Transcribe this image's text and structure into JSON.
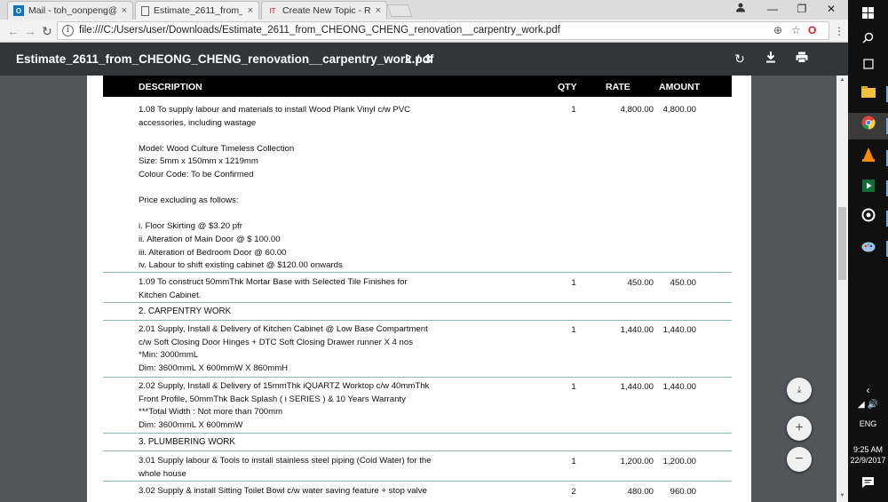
{
  "browser": {
    "tabs": [
      {
        "title": "Mail - toh_oonpeng@ho",
        "icon": "outlook-icon",
        "active": false
      },
      {
        "title": "Estimate_2611_from_CHE",
        "icon": "document-icon",
        "active": true
      },
      {
        "title": "Create New Topic - Reno",
        "icon": "forum-icon",
        "active": false
      }
    ],
    "url": "file:///C:/Users/user/Downloads/Estimate_2611_from_CHEONG_CHENG_renovation__carpentry_work.pdf",
    "tab_close": "×",
    "window_controls": {
      "minimize": "—",
      "restore": "❐",
      "close": "✕"
    }
  },
  "pdf": {
    "title": "Estimate_2611_from_CHEONG_CHENG_renovation__carpentry_work.pdf",
    "page_indicator": "2  /  3",
    "columns": {
      "description": "DESCRIPTION",
      "qty": "QTY",
      "rate": "RATE",
      "amount": "AMOUNT"
    },
    "rows": [
      {
        "desc": "1.08 To supply labour and materials to install Wood Plank Vinyl c/w PVC\naccessories, including wastage\n\nModel: Wood Culture Timeless Collection\nSize: 5mm x 150mm x 1219mm\nColour Code: To be Confirmed\n\nPrice excluding as follows:\n\ni. Floor Skirting @ $3.20 pfr\nii. Alteration of Main Door @ $ 100.00\niii. Alteration of Bedroom Door @ 60.00\niv. Labour to shift existing cabinet @ $120.00 onwards",
        "qty": "1",
        "rate": "4,800.00",
        "amount": "4,800.00"
      },
      {
        "desc": "1.09 To construct 50mmThk Mortar Base with Selected Tile Finishes for\nKitchen Cabinet.",
        "qty": "1",
        "rate": "450.00",
        "amount": "450.00"
      },
      {
        "desc": "2. CARPENTRY WORK",
        "qty": "",
        "rate": "",
        "amount": ""
      },
      {
        "desc": "2.01 Supply, Install & Delivery of Kitchen Cabinet @ Low Base Compartment\nc/w Soft Closing Door Hinges + DTC Soft Closing Drawer runner X 4 nos\n*Min: 3000mmL\nDim: 3600mmL X 600mmW X 860mmH",
        "qty": "1",
        "rate": "1,440.00",
        "amount": "1,440.00"
      },
      {
        "desc": "2.02 Supply, Install & Delivery of 15mmThk iQUARTZ Worktop c/w 40mmThk\nFront Profile, 50mmThk Back Splash ( i SERIES ) & 10 Years Warranty\n***Total Width : Not more than 700mm\nDim: 3600mmL X 600mmW",
        "qty": "1",
        "rate": "1,440.00",
        "amount": "1,440.00"
      },
      {
        "desc": "3. PLUMBERING WORK",
        "qty": "",
        "rate": "",
        "amount": ""
      },
      {
        "desc": "3.01 Supply labour & Tools to install stainless steel piping (Cold Water) for the\nwhole house",
        "qty": "1",
        "rate": "1,200.00",
        "amount": "1,200.00"
      },
      {
        "desc": "3.02 Supply & install Sitting Toilet Bowl c/w water saving feature + stop valve",
        "qty": "2",
        "rate": "480.00",
        "amount": "960.00"
      }
    ]
  },
  "system": {
    "language": "ENG",
    "time": "9:25 AM",
    "date": "22/9/2017"
  }
}
